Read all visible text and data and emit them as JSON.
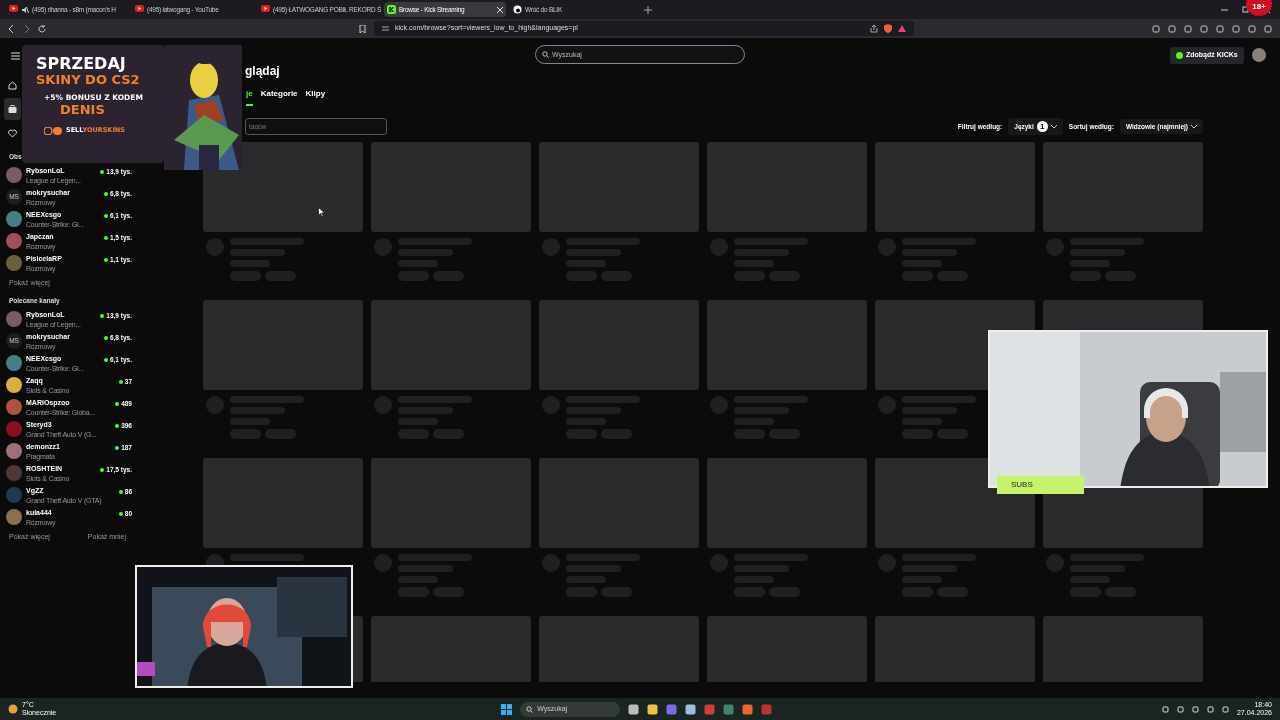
{
  "browser": {
    "tabs": [
      {
        "title": "(495) rihanna - s8m (macon's H",
        "kind": "youtube",
        "muted": true,
        "selected": false
      },
      {
        "title": "(495) łatwogang - YouTube",
        "kind": "youtube",
        "muted": false,
        "selected": false
      },
      {
        "title": "(495) ŁATWOGANG POBIŁ REKORD Ś",
        "kind": "youtube",
        "muted": false,
        "selected": false
      },
      {
        "title": "Browse - Kick Streaming",
        "kind": "kick",
        "muted": false,
        "selected": true
      },
      {
        "title": "Wróć do BLIK",
        "kind": "blik",
        "muted": false,
        "selected": false
      }
    ],
    "address": "kick.com/browse?sort=viewers_low_to_high&languages=pl"
  },
  "corner_badge": "18+",
  "header": {
    "search_placeholder": "Wyszukaj",
    "kicks_button": "Zdobądź KICKs"
  },
  "rail": [
    {
      "kind": "home",
      "selected": false
    },
    {
      "kind": "browse",
      "selected": true
    },
    {
      "kind": "heart",
      "selected": false
    }
  ],
  "followed": {
    "heading": "Obs",
    "more": "Pokaż więcej",
    "channels": [
      {
        "name": "RybsonLoL",
        "category": "League of Legen...",
        "viewers": "13,9 tys.",
        "color": "#7a5a6a"
      },
      {
        "name": "mokrysuchar",
        "category": "Rozmowy",
        "viewers": "6,8 tys.",
        "color": "#1e1e22",
        "initials": "MS"
      },
      {
        "name": "NEEXcsgo",
        "category": "Counter-Strike: Gl...",
        "viewers": "6,1 tys.",
        "color": "#4a7d86"
      },
      {
        "name": "Japczan",
        "category": "Rozmowy",
        "viewers": "1,5 tys.",
        "color": "#a0505a"
      },
      {
        "name": "PisicelaRP",
        "category": "Rozmowy",
        "viewers": "1,1 tys.",
        "color": "#6a6040"
      }
    ]
  },
  "recommended": {
    "heading": "Polecane kanały",
    "more": "Pokaż więcej",
    "less": "Pokaż mniej",
    "channels": [
      {
        "name": "RybsonLoL",
        "category": "League of Legen...",
        "viewers": "13,9 tys.",
        "color": "#7a5a6a"
      },
      {
        "name": "mokrysuchar",
        "category": "Rozmowy",
        "viewers": "6,8 tys.",
        "color": "#1e1e22",
        "initials": "MS"
      },
      {
        "name": "NEEXcsgo",
        "category": "Counter-Strike: Gl...",
        "viewers": "6,1 tys.",
        "color": "#4a7d86"
      },
      {
        "name": "Zaqq",
        "category": "Slots & Casino",
        "viewers": "37",
        "color": "#d8b040"
      },
      {
        "name": "MARIOspzoo",
        "category": "Counter-Strike: Globa...",
        "viewers": "489",
        "color": "#b05040"
      },
      {
        "name": "Steryd3",
        "category": "Grand Theft Auto V (G...",
        "viewers": "396",
        "color": "#8a1020"
      },
      {
        "name": "demonzz1",
        "category": "Pragmata",
        "viewers": "187",
        "color": "#a07078"
      },
      {
        "name": "ROSHTEIN",
        "category": "Slots & Casino",
        "viewers": "17,5 tys.",
        "color": "#503838"
      },
      {
        "name": "VgZZ",
        "category": "Grand Theft Auto V (GTA)",
        "viewers": "86",
        "color": "#203850"
      },
      {
        "name": "kula444",
        "category": "Rozmowy",
        "viewers": "80",
        "color": "#8a7050"
      }
    ]
  },
  "page": {
    "title": "glądaj",
    "tabs": [
      {
        "label": "je",
        "selected": true
      },
      {
        "label": "Kategorie",
        "selected": false
      },
      {
        "label": "Klipy",
        "selected": false
      }
    ],
    "tag_search_placeholder": "tagów",
    "filter_label": "Filtruj według:",
    "filter_value": "Języki",
    "filter_count": "1",
    "sort_label": "Sortuj według:",
    "sort_value": "Widzowie (najmniej)"
  },
  "ad": {
    "line1": "SPRZEDAJ",
    "line2": "SKINY DO CS2",
    "line3": "+5% BONUSU Z KODEM",
    "line4": "DENIS",
    "brand": [
      "SELL",
      "YOURSKINS"
    ]
  },
  "webcam": {
    "label": "SUBS"
  },
  "taskbar": {
    "temperature": "7°C",
    "weather": "Słonecznie",
    "search_placeholder": "Wyszukaj",
    "time": "18:40",
    "date": "27.04.2026"
  }
}
